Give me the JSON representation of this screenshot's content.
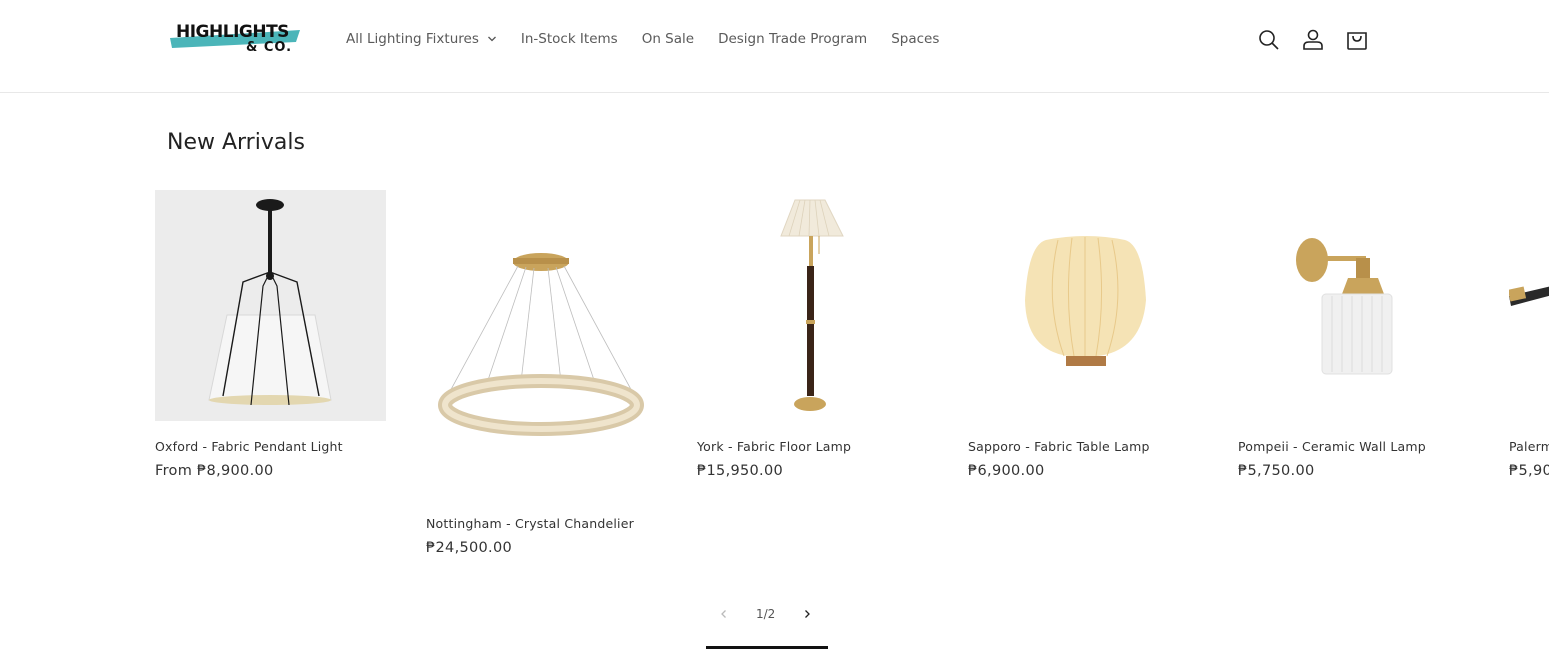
{
  "brand": {
    "logo_line1": "HIGHLIGHTS",
    "logo_line2": "& CO.",
    "accent": "#4bb5b9"
  },
  "nav": [
    {
      "label": "All Lighting Fixtures",
      "has_dropdown": true
    },
    {
      "label": "In-Stock Items"
    },
    {
      "label": "On Sale"
    },
    {
      "label": "Design Trade Program"
    },
    {
      "label": "Spaces"
    }
  ],
  "header_icons": [
    "search-icon",
    "account-icon",
    "cart-icon"
  ],
  "section": {
    "title": "New Arrivals"
  },
  "products": [
    {
      "name": "Oxford - Fabric Pendant Light",
      "price": "From ₱8,900.00"
    },
    {
      "name": "Nottingham - Crystal Chandelier",
      "price": "₱24,500.00"
    },
    {
      "name": "York - Fabric Floor Lamp",
      "price": "₱15,950.00"
    },
    {
      "name": "Sapporo - Fabric Table Lamp",
      "price": "₱6,900.00"
    },
    {
      "name": "Pompeii - Ceramic Wall Lamp",
      "price": "₱5,750.00"
    },
    {
      "name": "Palerm",
      "price": "₱5,90"
    }
  ],
  "slider": {
    "counter": "1/2",
    "progress": 0.5
  }
}
